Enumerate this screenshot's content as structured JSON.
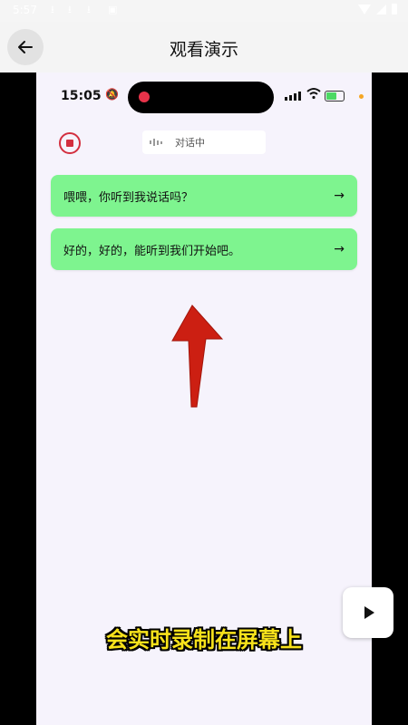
{
  "status_bar": {
    "time": "5:57"
  },
  "app_bar": {
    "back_icon": "back-arrow-icon",
    "title": "观看演示"
  },
  "phone": {
    "time": "15:05",
    "stop_icon": "stop-record-icon",
    "status_chip": {
      "icon": "waveform-icon",
      "text": "对话中"
    },
    "messages": [
      {
        "text": "喂喂，你听到我说话吗？",
        "icon": "arrow-right-icon"
      },
      {
        "text": "好的，好的，能听到我们开始吧。",
        "icon": "arrow-right-icon"
      }
    ],
    "caption": "会实时录制在屏幕上"
  },
  "play_button": {
    "icon": "play-icon"
  },
  "colors": {
    "message_bg": "#7ef48f",
    "caption": "#f7e21b",
    "stop": "#d32f3f",
    "annotation_arrow": "#cc1f12",
    "phone_bg": "#f6f3fc"
  }
}
